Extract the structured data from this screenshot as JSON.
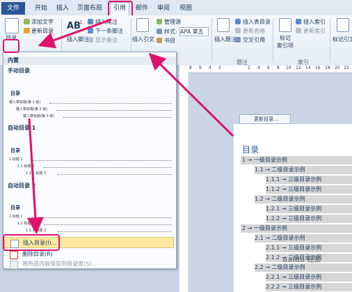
{
  "tabs": [
    "文件",
    "开始",
    "插入",
    "页面布局",
    "引用",
    "邮件",
    "审阅",
    "视图"
  ],
  "ribbon": {
    "toc_btn": "目录",
    "add_text": "添加文字",
    "update_toc": "更新目录",
    "insert_footnote_big": "AB",
    "footnote_sup": "1",
    "insert_endnote": "插入尾注",
    "insert_footnote": "插入脚注",
    "next_footnote": "下一条脚注",
    "show_notes": "显示备注",
    "insert_citation": "插入引文",
    "manage_sources": "管理源",
    "style_label": "样式:",
    "style_value": "APA 第五",
    "bibliography": "书目",
    "insert_caption": "插入题注",
    "insert_table_of_figures": "插入表目录",
    "update_table": "更新表格",
    "cross_reference": "交叉引用",
    "caption_group": "题注",
    "mark_entry": "标记",
    "mark_entry2": "索引项",
    "insert_index": "插入索引",
    "update_index": "更新索引",
    "index_group": "索引",
    "mark_citation": "标记引文"
  },
  "ruler": [
    "8",
    "6",
    "4",
    "2",
    "",
    "2",
    "4",
    "6",
    "8",
    "10",
    "12",
    "14",
    "16",
    "18",
    "20",
    "22"
  ],
  "dropdown": {
    "builtin": "内置",
    "manual_toc": "手动目录",
    "toc_title": "目录",
    "manual_lines": [
      "键入章标题(第 1 级)",
      "键入章标题(第 2 级)",
      "键入章标题(第 3 级)"
    ],
    "auto1": "自动目录 1",
    "auto_lines": [
      "1   标题 1",
      "1.1    标题 2",
      "1.1.1    标题 3"
    ],
    "auto2": "自动目录 2",
    "insert_toc": "插入目录(I)...",
    "delete_toc": "删除目录(R)",
    "save_selection": "将所选内容保存到目录库(S)..."
  },
  "document": {
    "update_toc_btn": "更新目录...",
    "title": "目录",
    "lines": [
      "1 → 一级目录示例",
      "1.1 → 二级目录示例",
      "1.1.1 → 三级目录示例",
      "1.1.2 → 三级目录示例",
      "1.2 → 二级目录示例",
      "1.2.1 → 三级目录示例",
      "1.2.2 → 三级目录示例",
      "2 → 一级目录示例",
      "2.1 → 二级目录示例",
      "2.1.1 → 三级目录示例",
      "2.1.2 → 三级目录示例",
      "2.2 → 二级目录示例",
      "2.2.1 → 三级目录示例",
      "2.2.2 → 三级目录示例"
    ]
  },
  "watermark": "Baidu 经验",
  "colors": {
    "accent": "#e0106e",
    "tab_file": "#2b5797",
    "highlight": "#fde9a2"
  }
}
